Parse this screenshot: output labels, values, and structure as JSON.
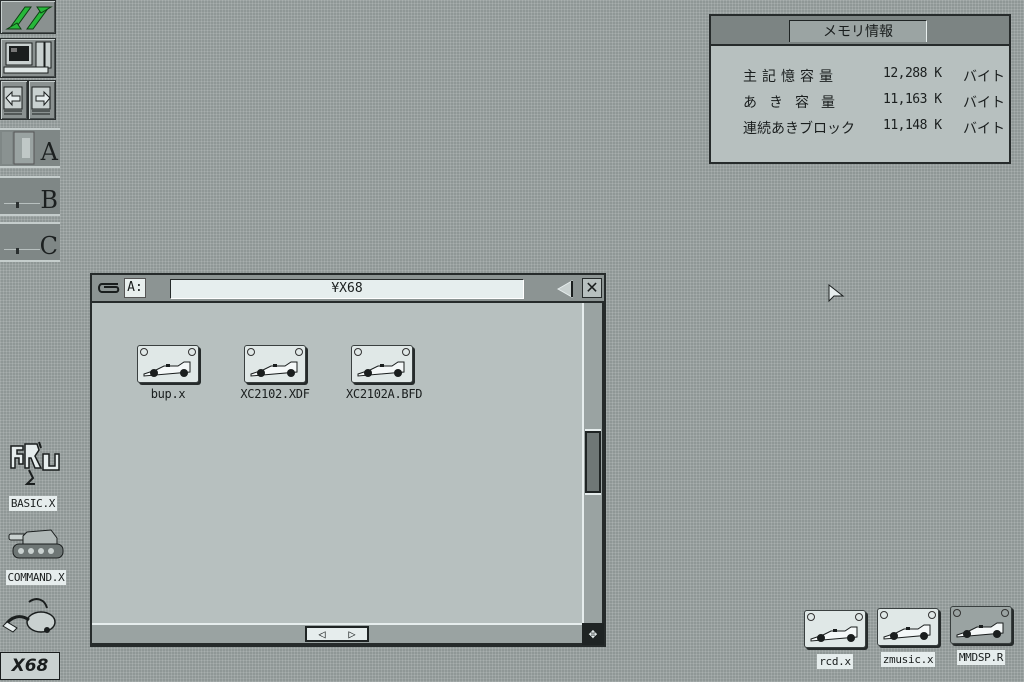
{
  "dock": {
    "items": [
      {
        "name": "sx-logo",
        "label": "SX"
      },
      {
        "name": "computer",
        "label": ""
      },
      {
        "name": "back-arrow",
        "label": ""
      },
      {
        "name": "forward-arrow",
        "label": ""
      }
    ],
    "drives": [
      {
        "letter": "A",
        "state": "inserted"
      },
      {
        "letter": "B",
        "state": "empty"
      },
      {
        "letter": "C",
        "state": "empty"
      }
    ],
    "colors": {
      "logo_green": "#27b83a"
    }
  },
  "desktop_icons_left": [
    {
      "label": "BASIC.X",
      "icon": "run-icon"
    },
    {
      "label": "COMMAND.X",
      "icon": "tank-icon"
    },
    {
      "label": "",
      "icon": "vacuum-trash-icon"
    },
    {
      "label": "X68",
      "icon": "x68-logo"
    }
  ],
  "memory_window": {
    "title": "メモリ情報",
    "rows": [
      {
        "label": "主記憶容量",
        "value": "12,288 K",
        "unit": "バイト"
      },
      {
        "label": "あき容量",
        "value": "11,163 K",
        "unit": "バイト"
      },
      {
        "label": "連続あきブロック",
        "value": "11,148 K",
        "unit": "バイト"
      }
    ]
  },
  "file_window": {
    "drive": "A:",
    "path": "¥X68",
    "files": [
      {
        "label": "bup.x"
      },
      {
        "label": "XC2102.XDF"
      },
      {
        "label": "XC2102A.BFD"
      }
    ],
    "scroll_left": "◁",
    "scroll_right": "▷",
    "close": "✕"
  },
  "desktop_icons_bottom": [
    {
      "label": "rcd.x"
    },
    {
      "label": "zmusic.x"
    },
    {
      "label": "MMDSP.R"
    }
  ]
}
